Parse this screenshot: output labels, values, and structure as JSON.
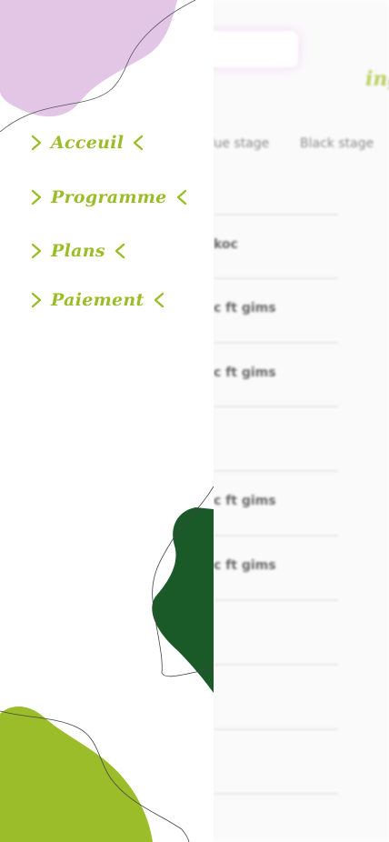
{
  "background": {
    "title": "ing",
    "tabs": [
      "Blue stage",
      "Black stage"
    ],
    "rows": [
      "koc",
      "c ft gims",
      "c ft gims",
      "",
      "c ft gims",
      "c ft gims",
      "",
      "",
      ""
    ]
  },
  "menu": {
    "items": [
      {
        "label": "Acceuil"
      },
      {
        "label": "Programme"
      },
      {
        "label": "Plans"
      },
      {
        "label": "Paiement"
      }
    ]
  },
  "colors": {
    "accent_green": "#9cbd2a",
    "dark_green": "#1a5a28",
    "lilac": "#e3c6e6"
  },
  "icons": {
    "left": "chevron-right-icon",
    "right": "chevron-left-icon"
  }
}
